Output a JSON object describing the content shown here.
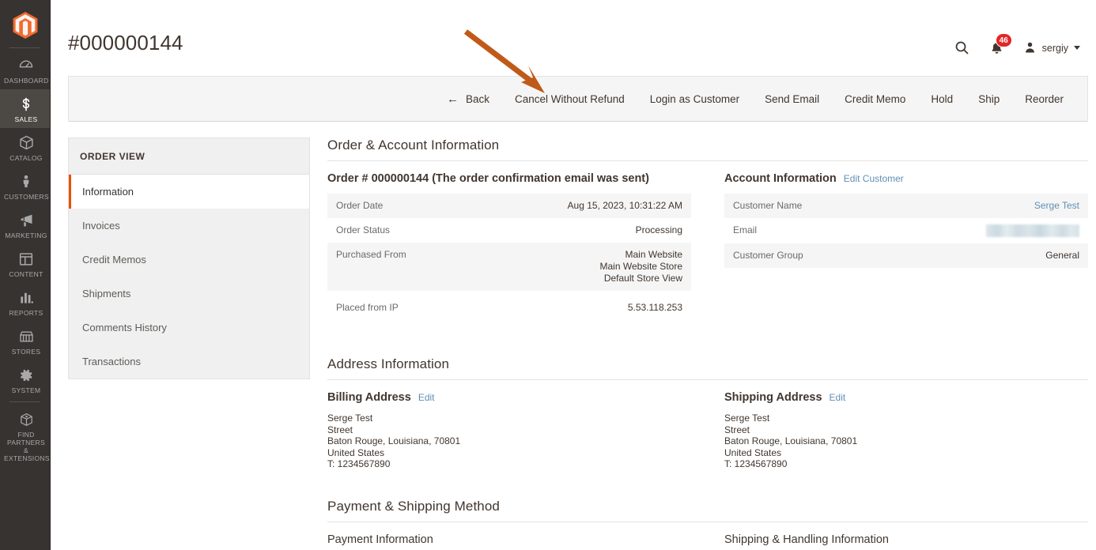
{
  "sidebar": {
    "logo_name": "magento-logo",
    "items": [
      {
        "label": "Dashboard",
        "icon": "dashboard-icon",
        "active": false
      },
      {
        "label": "Sales",
        "icon": "dollar-icon",
        "active": true
      },
      {
        "label": "Catalog",
        "icon": "box-icon",
        "active": false
      },
      {
        "label": "Customers",
        "icon": "person-icon",
        "active": false
      },
      {
        "label": "Marketing",
        "icon": "megaphone-icon",
        "active": false
      },
      {
        "label": "Content",
        "icon": "layout-icon",
        "active": false
      },
      {
        "label": "Reports",
        "icon": "bar-chart-icon",
        "active": false
      },
      {
        "label": "Stores",
        "icon": "storefront-icon",
        "active": false
      },
      {
        "label": "System",
        "icon": "gear-icon",
        "active": false
      },
      {
        "label": "Find Partners & Extensions",
        "icon": "puzzle-box-icon",
        "active": false
      }
    ]
  },
  "header": {
    "page_title": "#000000144",
    "search_icon": "search-icon",
    "notifications_icon": "bell-icon",
    "notifications_count": "46",
    "user_icon": "user-avatar-icon",
    "user_name": "sergiy",
    "caret_icon": "chevron-down-icon"
  },
  "action_buttons": [
    {
      "label": "Back",
      "icon": "arrow-left-icon"
    },
    {
      "label": "Cancel Without Refund",
      "icon": ""
    },
    {
      "label": "Login as Customer",
      "icon": ""
    },
    {
      "label": "Send Email",
      "icon": ""
    },
    {
      "label": "Credit Memo",
      "icon": ""
    },
    {
      "label": "Hold",
      "icon": ""
    },
    {
      "label": "Ship",
      "icon": ""
    },
    {
      "label": "Reorder",
      "icon": ""
    }
  ],
  "order_view_nav": {
    "title": "ORDER VIEW",
    "items": [
      {
        "label": "Information",
        "active": true
      },
      {
        "label": "Invoices",
        "active": false
      },
      {
        "label": "Credit Memos",
        "active": false
      },
      {
        "label": "Shipments",
        "active": false
      },
      {
        "label": "Comments History",
        "active": false
      },
      {
        "label": "Transactions",
        "active": false
      }
    ]
  },
  "order_account_section": {
    "title": "Order & Account Information",
    "order_heading": "Order # 000000144 (The order confirmation email was sent)",
    "order_rows": [
      {
        "label": "Order Date",
        "value": "Aug 15, 2023, 10:31:22 AM"
      },
      {
        "label": "Order Status",
        "value": "Processing"
      },
      {
        "label": "Purchased From",
        "value": "Main Website\nMain Website Store\nDefault Store View"
      },
      {
        "label": "Placed from IP",
        "value": "5.53.118.253"
      }
    ],
    "account_heading": "Account Information",
    "account_edit_link": "Edit Customer",
    "account_rows": [
      {
        "label": "Customer Name",
        "value": "Serge Test",
        "is_link": true,
        "redacted": false
      },
      {
        "label": "Email",
        "value": "",
        "is_link": false,
        "redacted": true
      },
      {
        "label": "Customer Group",
        "value": "General",
        "is_link": false,
        "redacted": false
      }
    ]
  },
  "address_section": {
    "title": "Address Information",
    "billing": {
      "heading": "Billing Address",
      "edit_link": "Edit",
      "lines": [
        "Serge Test",
        "Street",
        "Baton Rouge, Louisiana, 70801",
        "United States",
        "T: 1234567890"
      ]
    },
    "shipping": {
      "heading": "Shipping Address",
      "edit_link": "Edit",
      "lines": [
        "Serge Test",
        "Street",
        "Baton Rouge, Louisiana, 70801",
        "United States",
        "T: 1234567890"
      ]
    }
  },
  "payment_shipping_section": {
    "title": "Payment & Shipping Method",
    "payment_heading": "Payment Information",
    "shipping_heading": "Shipping & Handling Information"
  },
  "annotation": {
    "type": "arrow",
    "color": "#c05a19",
    "points_to": "Cancel Without Refund"
  },
  "colors": {
    "sidebar_bg": "#373330",
    "accent_orange": "#eb5202",
    "link_blue": "#5f8fb3",
    "badge_red": "#e22626",
    "row_stripe": "#f5f5f5"
  }
}
